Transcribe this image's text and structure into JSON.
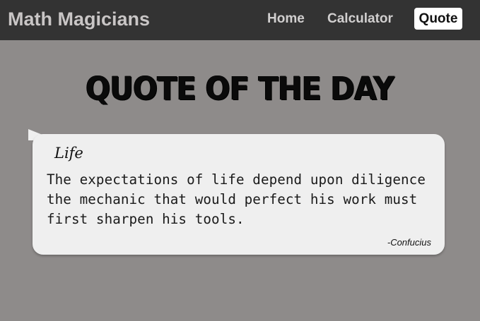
{
  "app": {
    "brand": "Math Magicians"
  },
  "nav": {
    "items": [
      {
        "label": "Home",
        "active": false
      },
      {
        "label": "Calculator",
        "active": false
      },
      {
        "label": "Quote",
        "active": true
      }
    ]
  },
  "main": {
    "title": "QUOTE OF THE DAY",
    "quote": {
      "category": "Life",
      "text": "The expectations of life depend upon diligence the mechanic that would perfect his work must first sharpen his tools.",
      "author": "-Confucius"
    }
  },
  "colors": {
    "navbar_bg": "#333333",
    "page_bg": "#8e8b8a",
    "bubble_bg": "#efefef",
    "active_link_bg": "#ffffff"
  }
}
